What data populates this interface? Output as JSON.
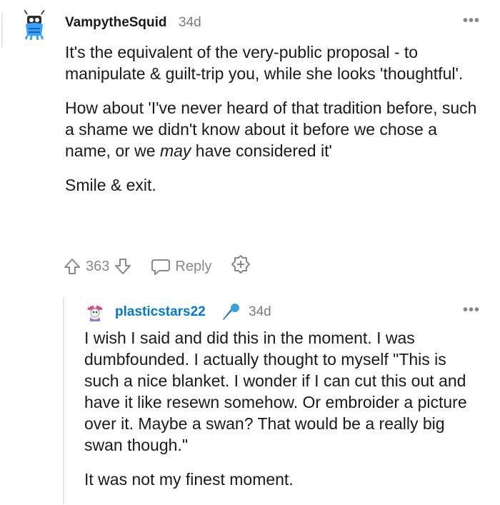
{
  "comments": [
    {
      "username": "VampytheSquid",
      "age": "34d",
      "more": "•••",
      "paragraphs": [
        "It's the equivalent of the very-public proposal - to manipulate & guilt-trip you, while she looks 'thoughtful'.",
        "How about 'I've never heard of that tradition before, such a shame we didn't know about it before we chose a name, or we ",
        "Smile & exit."
      ],
      "emphasis": "may",
      "paragraph2_tail": " have considered it'",
      "votes": "363",
      "reply_label": "Reply"
    },
    {
      "username": "plasticstars22",
      "age": "34d",
      "more": "•••",
      "flair_icon": "microphone-icon",
      "paragraphs": [
        "I wish I said and did this in the moment. I was dumbfounded. I actually thought to myself \"This is such a nice blanket. I wonder if I can cut this out and have it like resewn somehow. Or embroider a picture over it. Maybe a swan? That would be a really big swan though.\"",
        "It was not my finest moment."
      ]
    }
  ],
  "colors": {
    "text": "#1a1a1b",
    "meta": "#7c7c7c",
    "link_username": "#0079d3",
    "icon": "#878a8c",
    "thread_line": "#e6e6e6"
  }
}
